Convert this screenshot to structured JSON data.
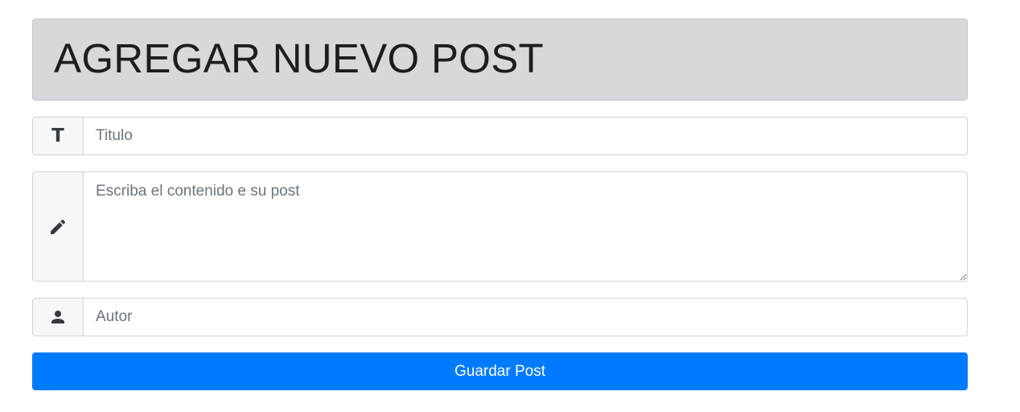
{
  "header": {
    "title": "AGREGAR NUEVO POST"
  },
  "form": {
    "title_field": {
      "icon": "text-t-icon",
      "icon_glyph": "T",
      "placeholder": "Titulo",
      "value": ""
    },
    "content_field": {
      "icon": "pencil-icon",
      "placeholder": "Escriba el contenido e su post",
      "value": ""
    },
    "author_field": {
      "icon": "user-icon",
      "placeholder": "Autor",
      "value": ""
    },
    "submit_label": "Guardar Post"
  },
  "colors": {
    "header_background": "#d6d8db",
    "primary_button": "#007bff",
    "addon_background": "#f6f7f8",
    "border": "#ced4da"
  }
}
